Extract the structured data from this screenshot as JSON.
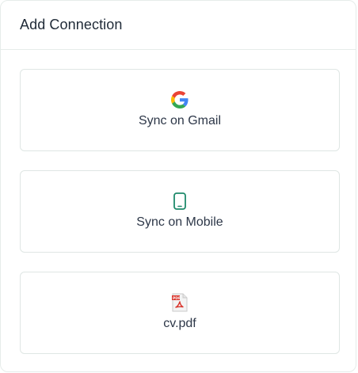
{
  "card": {
    "title": "Add Connection"
  },
  "options": [
    {
      "label": "Sync on Gmail",
      "icon": "google-icon"
    },
    {
      "label": "Sync on Mobile",
      "icon": "mobile-phone-icon"
    },
    {
      "label": "cv.pdf",
      "icon": "pdf-file-icon"
    }
  ],
  "colors": {
    "border": "#e6ecea",
    "mobile_icon": "#1f8a6b",
    "pdf_red": "#d9342b",
    "google_blue": "#4285F4",
    "google_red": "#EA4335",
    "google_yellow": "#FBBC05",
    "google_green": "#34A853"
  }
}
